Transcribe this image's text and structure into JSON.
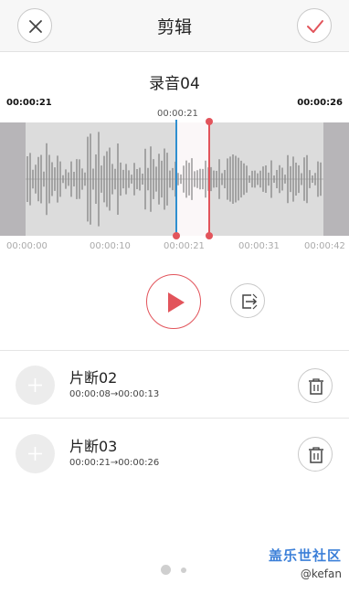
{
  "header": {
    "title": "剪辑",
    "close_icon": "close-icon",
    "confirm_icon": "checkmark-icon"
  },
  "recording": {
    "name": "录音04",
    "start_time": "00:00:21",
    "end_time": "00:00:26",
    "cursor_time": "00:00:21",
    "selection_start_fraction": 0.5,
    "selection_end_fraction": 0.619
  },
  "timeline": {
    "ticks": [
      "00:00:00",
      "00:00:10",
      "00:00:21",
      "00:00:31",
      "00:00:42"
    ]
  },
  "controls": {
    "play_icon": "play-icon",
    "split_icon": "split-clip-icon"
  },
  "clips": [
    {
      "name": "片断02",
      "range": "00:00:08→00:00:13"
    },
    {
      "name": "片断03",
      "range": "00:00:21→00:00:26"
    }
  ],
  "pager": {
    "pages": 2,
    "active": 0
  },
  "watermark": {
    "main": "盖乐世社区",
    "sub": "@kefan"
  },
  "colors": {
    "accent": "#e2545b",
    "marker_blue": "#2f8fd0",
    "wave_bg": "#dcdcdc"
  }
}
